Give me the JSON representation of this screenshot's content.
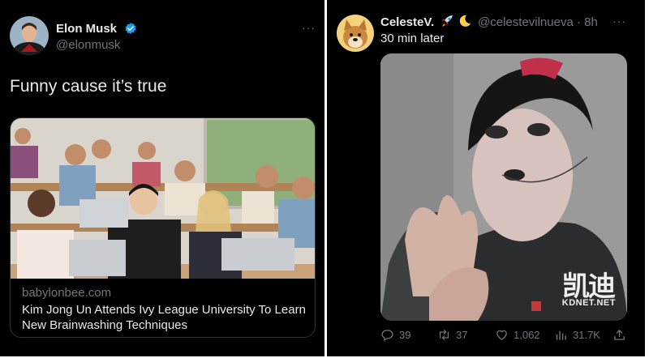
{
  "left_tweet": {
    "author_name": "Elon Musk",
    "handle": "@elonmusk",
    "more": "···",
    "text": "Funny cause it’s true",
    "card": {
      "domain": "babylonbee.com",
      "title": "Kim Jong Un Attends Ivy League University To Learn New Brainwashing Techniques"
    }
  },
  "right_tweet": {
    "author_name": "CelesteV.",
    "meta": "@celestevilnueva · 8h",
    "more": "···",
    "text": "30 min later",
    "watermark_cn": "凯迪",
    "watermark": "KDNET.NET",
    "actions": {
      "replies": "39",
      "retweets": "37",
      "likes": "1,062",
      "views": "31.7K"
    }
  },
  "colors": {
    "background": "#000000",
    "text": "#e7e9ea",
    "secondary": "#71767b",
    "verified": "#1d9bf0",
    "border": "#2f3336"
  },
  "icons": [
    "verified-badge-icon",
    "rocket-emoji-icon",
    "crescent-moon-emoji-icon",
    "reply-icon",
    "retweet-icon",
    "like-icon",
    "views-icon",
    "share-icon",
    "more-options-icon"
  ]
}
